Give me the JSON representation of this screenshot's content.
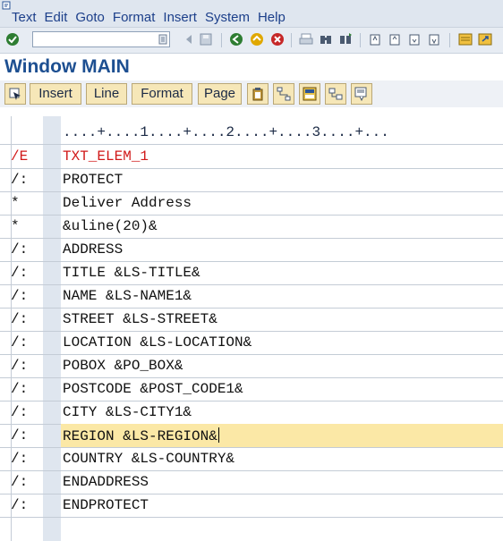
{
  "menubar": {
    "items": [
      "Text",
      "Edit",
      "Goto",
      "Format",
      "Insert",
      "System",
      "Help"
    ]
  },
  "toolbar": {
    "command_field": {
      "value": "",
      "placeholder": ""
    },
    "icons": [
      "enter-icon",
      "history-dropdown-icon",
      "back-arrow-icon",
      "save-icon",
      "back-icon",
      "exit-icon",
      "cancel-icon",
      "print-icon",
      "find-icon",
      "find-next-icon",
      "first-page-icon",
      "previous-page-icon",
      "next-page-icon",
      "last-page-icon",
      "create-session-icon",
      "shortcut-icon"
    ]
  },
  "title": "Window MAIN",
  "app_toolbar": {
    "insert_label": "Insert",
    "line_label": "Line",
    "format_label": "Format",
    "page_label": "Page"
  },
  "editor": {
    "ruler": "....+....1....+....2....+....3....+...",
    "lines": [
      {
        "fmt": "/E",
        "text": "TXT_ELEM_1"
      },
      {
        "fmt": "/:",
        "text": "PROTECT"
      },
      {
        "fmt": "*",
        "text": "Deliver Address"
      },
      {
        "fmt": "*",
        "text": "&uline(20)&"
      },
      {
        "fmt": "/:",
        "text": "ADDRESS"
      },
      {
        "fmt": "/:",
        "text": "TITLE &LS-TITLE&"
      },
      {
        "fmt": "/:",
        "text": "NAME &LS-NAME1&"
      },
      {
        "fmt": "/:",
        "text": "STREET &LS-STREET&"
      },
      {
        "fmt": "/:",
        "text": "LOCATION &LS-LOCATION&"
      },
      {
        "fmt": "/:",
        "text": "POBOX &PO_BOX&"
      },
      {
        "fmt": "/:",
        "text": "POSTCODE &POST_CODE1&"
      },
      {
        "fmt": "/:",
        "text": "CITY &LS-CITY1&"
      },
      {
        "fmt": "/:",
        "text": "REGION &LS-REGION&"
      },
      {
        "fmt": "/:",
        "text": "COUNTRY &LS-COUNTRY&"
      },
      {
        "fmt": "/:",
        "text": "ENDADDRESS"
      },
      {
        "fmt": "/:",
        "text": "ENDPROTECT"
      }
    ]
  },
  "colors": {
    "title": "#1d4f91",
    "menu_text": "#1c3f8a",
    "element_marker": "#d11a1a",
    "current_line": "#fbe8a6",
    "button_bg": "#f6e7b8"
  }
}
